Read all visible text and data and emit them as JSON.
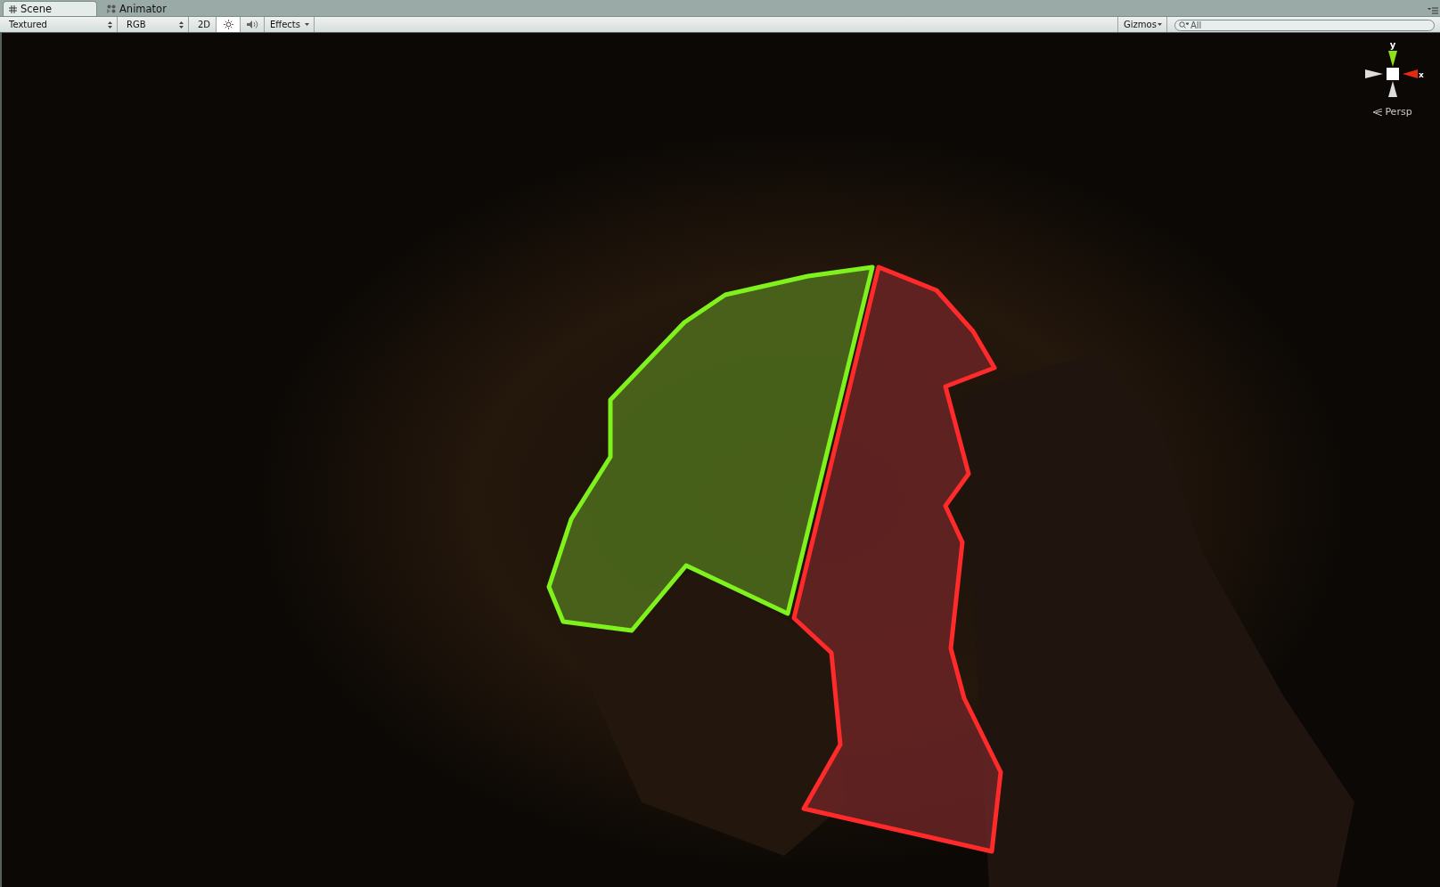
{
  "tabs": [
    {
      "label": "Scene",
      "selected": true
    },
    {
      "label": "Animator",
      "selected": false
    }
  ],
  "toolbar": {
    "draw_mode": "Textured",
    "render_mode": "RGB",
    "buttons": [
      {
        "kind": "text",
        "label": "2D",
        "selected": false
      },
      {
        "kind": "light",
        "selected": true
      },
      {
        "kind": "audio",
        "selected": false
      }
    ],
    "effects": "Effects",
    "gizmos": "Gizmos",
    "search": {
      "placeholder": "All"
    }
  },
  "gizmo": {
    "y_label": "y",
    "x_label": "x",
    "projection": "Persp"
  }
}
